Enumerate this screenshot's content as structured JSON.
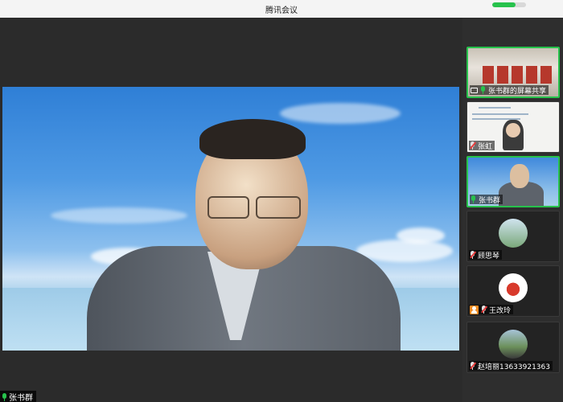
{
  "app": {
    "title": "腾讯会议",
    "signal_level": 0.7
  },
  "main": {
    "speaker_name": "张书群",
    "mic_icon": "mic-on-icon"
  },
  "sidebar": {
    "tiles": [
      {
        "label": "张书群的屏幕共享",
        "kind": "screen-share",
        "active": true
      },
      {
        "label": "张虹",
        "kind": "video"
      },
      {
        "label": "张书群",
        "kind": "video",
        "active": true
      },
      {
        "label": "顾思琴",
        "kind": "avatar"
      },
      {
        "label": "王改玲",
        "kind": "avatar"
      },
      {
        "label": "赵培丽13633921363",
        "kind": "avatar"
      }
    ]
  },
  "colors": {
    "accent": "#27c24c",
    "muted": "#e83b3b",
    "badge": "#f08b22"
  }
}
